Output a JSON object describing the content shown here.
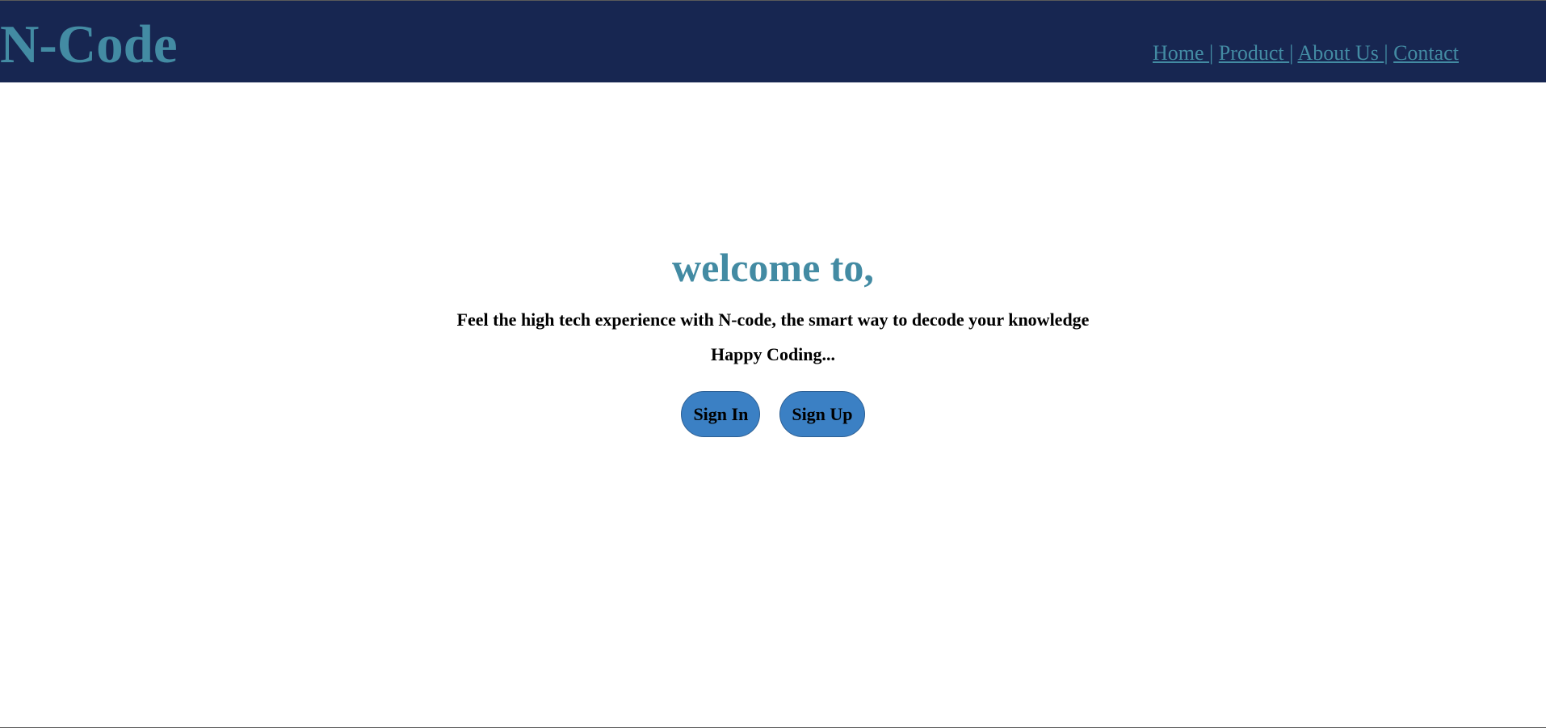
{
  "header": {
    "brand": "N-Code",
    "nav": [
      {
        "label": "Home "
      },
      {
        "label": "Product "
      },
      {
        "label": "About Us "
      },
      {
        "label": "Contact"
      }
    ],
    "separator": "|"
  },
  "hero": {
    "title": "welcome to,",
    "tagline": "Feel the high tech experience with N-code, the smart way to decode your knowledge",
    "subline": "Happy Coding..."
  },
  "buttons": {
    "sign_in": "Sign In",
    "sign_up": "Sign Up"
  },
  "colors": {
    "header_bg": "#172651",
    "accent": "#438ba3",
    "button_bg": "#3b80c4"
  }
}
